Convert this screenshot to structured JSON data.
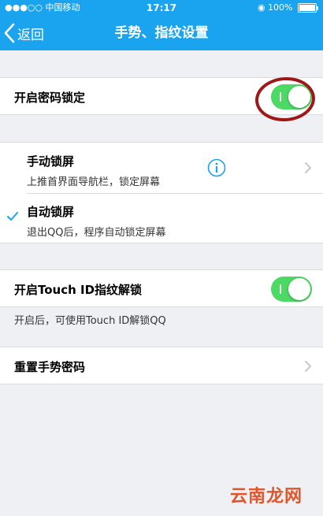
{
  "status_bar": {
    "carrier": "●●●○○ 中国移动",
    "time": "17:17",
    "battery": "100%"
  },
  "nav": {
    "back_label": "返回",
    "title": "手势、指纹设置"
  },
  "password_lock": {
    "label": "开启密码锁定",
    "enabled": true
  },
  "lock_options": [
    {
      "title": "手动锁屏",
      "subtitle": "上推首界面导航栏，锁定屏幕",
      "selected": false
    },
    {
      "title": "自动锁屏",
      "subtitle": "退出QQ后，程序自动锁定屏幕",
      "selected": true
    }
  ],
  "touch_id": {
    "label": "开启Touch ID指纹解锁",
    "enabled": true,
    "note": "开启后，可使用Touch ID解锁QQ"
  },
  "reset": {
    "label": "重置手势密码"
  },
  "watermark": "云南龙网",
  "colors": {
    "nav_bg": "#1aa3ee",
    "toggle_on": "#4cd964",
    "annotation_ring": "#a01717",
    "accent": "#1aa3ee"
  }
}
